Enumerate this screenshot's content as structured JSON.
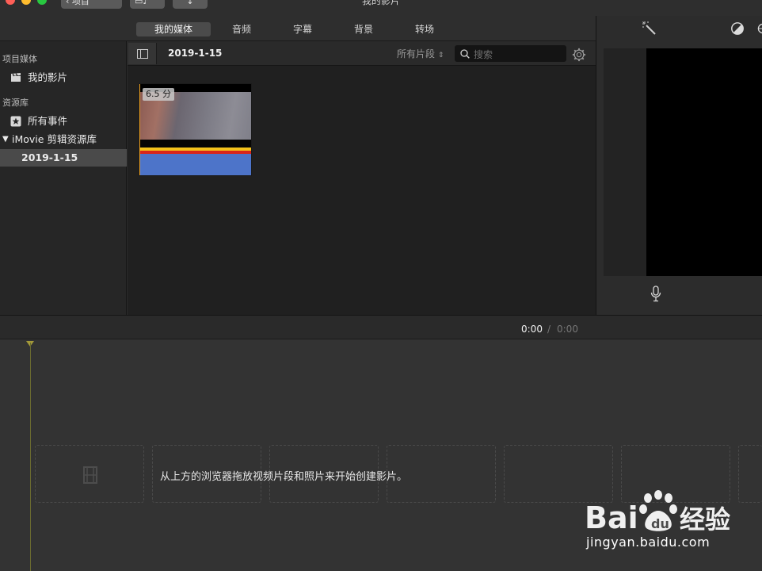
{
  "window": {
    "title": "我的影片",
    "back_label": "项目",
    "traffic_colors": [
      "#fe5f57",
      "#febc2e",
      "#28c840"
    ]
  },
  "tabs": [
    {
      "label": "我的媒体",
      "active": true
    },
    {
      "label": "音频",
      "active": false
    },
    {
      "label": "字幕",
      "active": false
    },
    {
      "label": "背景",
      "active": false
    },
    {
      "label": "转场",
      "active": false
    }
  ],
  "sidebar": {
    "section_project": "项目媒体",
    "project_item": "我的影片",
    "section_libraries": "资源库",
    "all_events": "所有事件",
    "library_name": "iMovie 剪辑资源库",
    "event_item": "2019-1-15"
  },
  "browser": {
    "event_title": "2019-1-15",
    "filter_label": "所有片段",
    "search_placeholder": "搜索",
    "clip_duration": "6.5 分"
  },
  "timeline": {
    "current_time": "0:00",
    "separator": "/",
    "total_time": "0:00",
    "hint": "从上方的浏览器拖放视频片段和照片来开始创建影片。"
  },
  "watermark": {
    "brand": "Baidu 经验",
    "url": "jingyan.baidu.com"
  },
  "colors": {
    "accent_selected": "#4a4a4a",
    "clip_marker": "#f0a21e",
    "playhead": "#a49a3a"
  }
}
